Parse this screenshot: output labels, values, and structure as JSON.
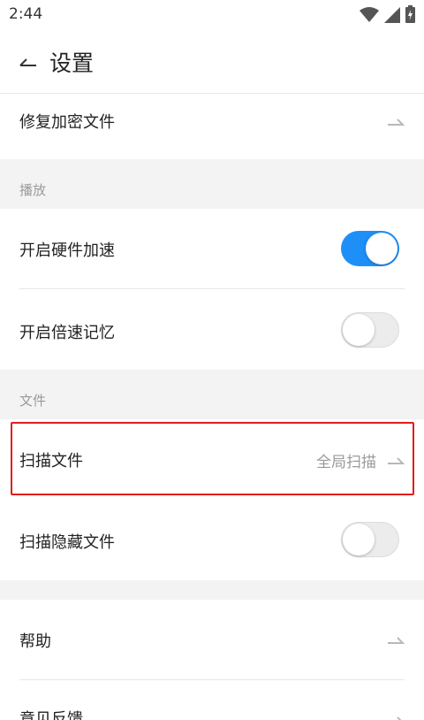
{
  "status_bar": {
    "time": "2:44",
    "icons": [
      "wifi-icon",
      "signal-icon",
      "battery-charging-icon"
    ]
  },
  "header": {
    "title": "设置",
    "back_icon": "back-arrow-icon"
  },
  "rows": {
    "repair_encrypted": "修复加密文件",
    "section_playback": "播放",
    "hw_accel": {
      "label": "开启硬件加速",
      "enabled": true
    },
    "speed_memory": {
      "label": "开启倍速记忆",
      "enabled": false
    },
    "section_file": "文件",
    "scan_files": {
      "label": "扫描文件",
      "value": "全局扫描"
    },
    "scan_hidden": {
      "label": "扫描隐藏文件",
      "enabled": false
    },
    "help": "帮助",
    "feedback": "意见反馈"
  },
  "colors": {
    "accent": "#1e8ff7",
    "highlight": "#e41c1c",
    "section_bg": "#f3f3f3"
  }
}
